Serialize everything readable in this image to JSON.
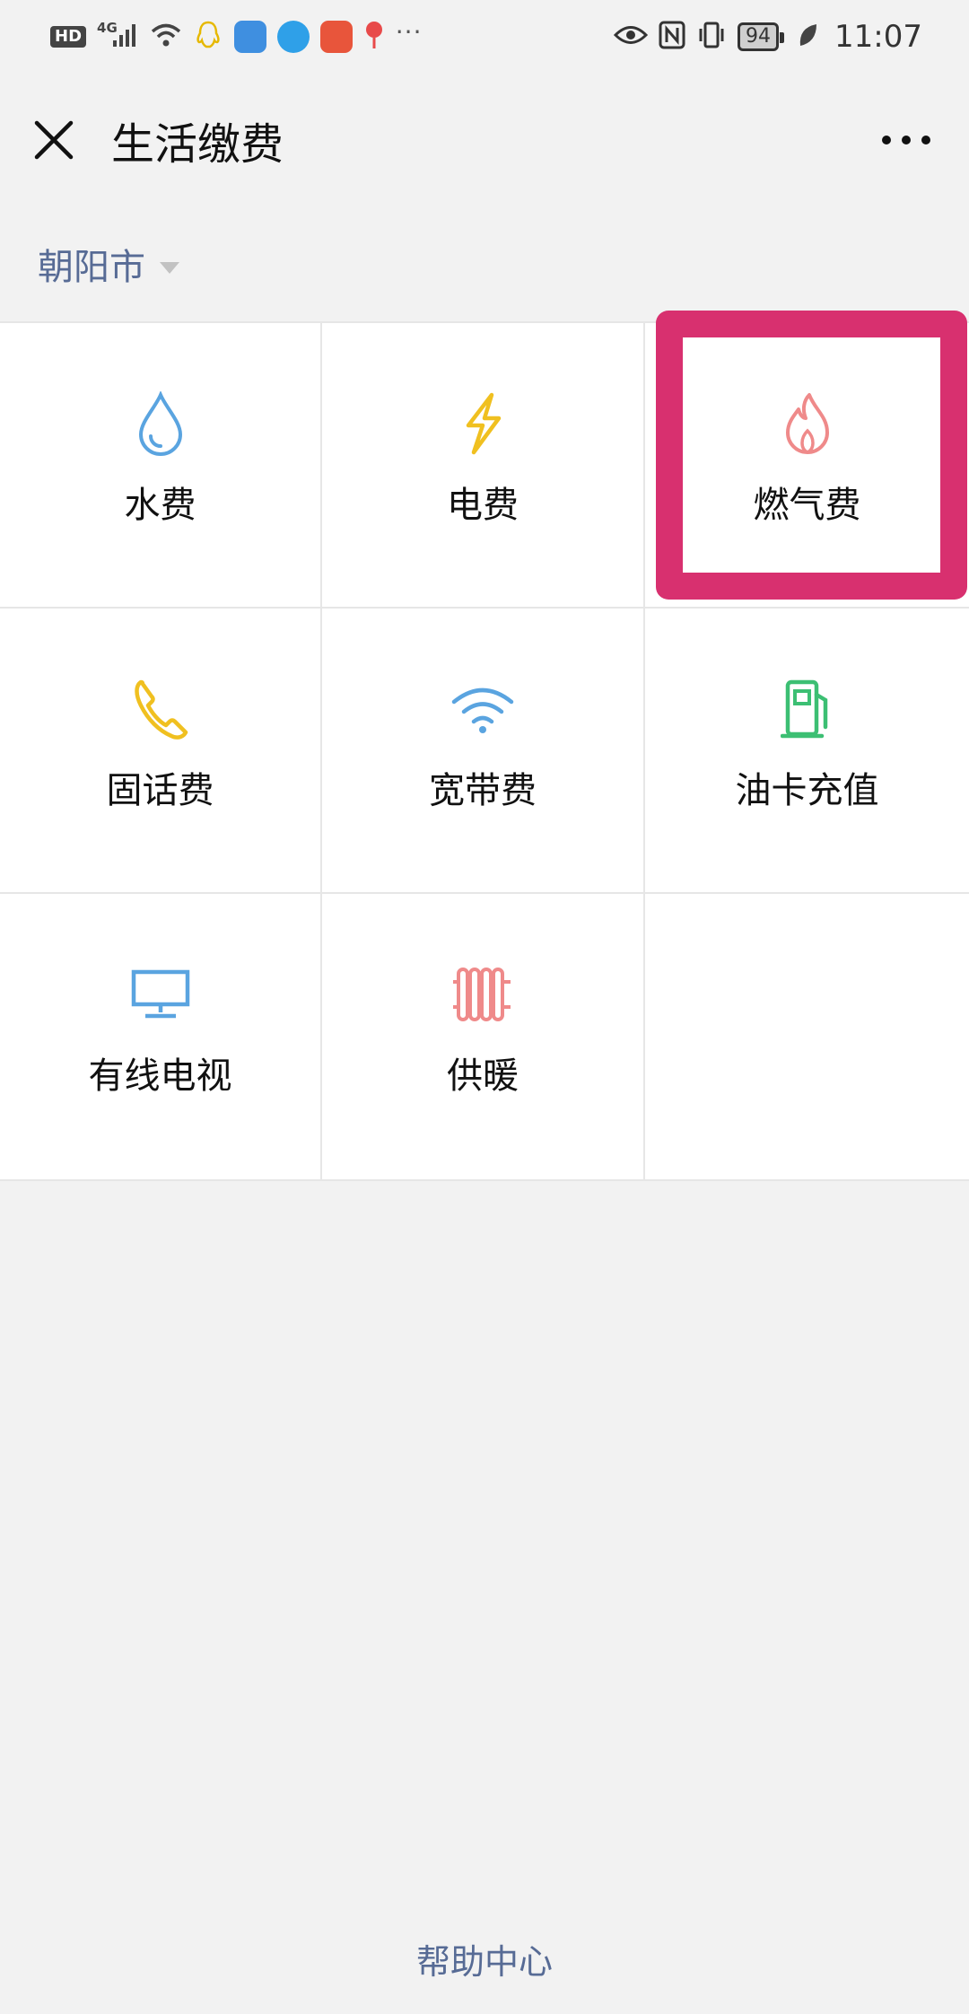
{
  "status_bar": {
    "hd": "HD",
    "network": "4G",
    "battery": "94",
    "time": "11:07"
  },
  "title_bar": {
    "title": "生活缴费"
  },
  "city": {
    "name": "朝阳市"
  },
  "services": [
    {
      "label": "水费",
      "icon": "water-drop-icon",
      "color": "#5aa4e0"
    },
    {
      "label": "电费",
      "icon": "lightning-icon",
      "color": "#f0c020"
    },
    {
      "label": "燃气费",
      "icon": "flame-icon",
      "color": "#ef8a8a"
    },
    {
      "label": "固话费",
      "icon": "phone-icon",
      "color": "#f0c020"
    },
    {
      "label": "宽带费",
      "icon": "wifi-icon",
      "color": "#5aa4e0"
    },
    {
      "label": "油卡充值",
      "icon": "gas-pump-icon",
      "color": "#3cbf73"
    },
    {
      "label": "有线电视",
      "icon": "tv-icon",
      "color": "#5aa4e0"
    },
    {
      "label": "供暖",
      "icon": "radiator-icon",
      "color": "#ef8a8a"
    }
  ],
  "highlight_color": "#d8306f",
  "link_color": "#576b95",
  "footer": {
    "help": "帮助中心"
  }
}
